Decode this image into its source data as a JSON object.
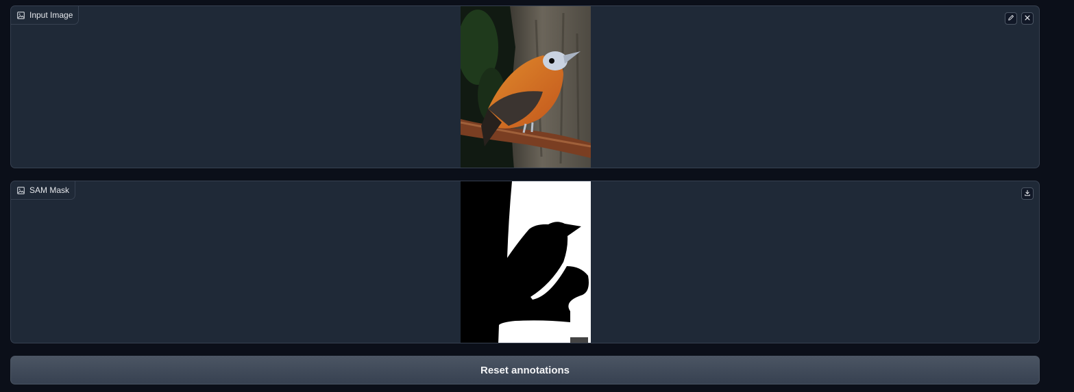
{
  "input_panel": {
    "label": "Input Image",
    "icon": "image-icon",
    "buttons": [
      "edit-icon",
      "close-icon"
    ]
  },
  "mask_panel": {
    "label": "SAM Mask",
    "icon": "image-icon",
    "buttons": [
      "download-icon"
    ]
  },
  "reset_button": {
    "label": "Reset annotations"
  },
  "colors": {
    "page_bg": "#0b0f19",
    "panel_bg": "#1f2937",
    "panel_border": "#374151",
    "button_bg": "#4b5563",
    "text": "#e5e7eb"
  }
}
